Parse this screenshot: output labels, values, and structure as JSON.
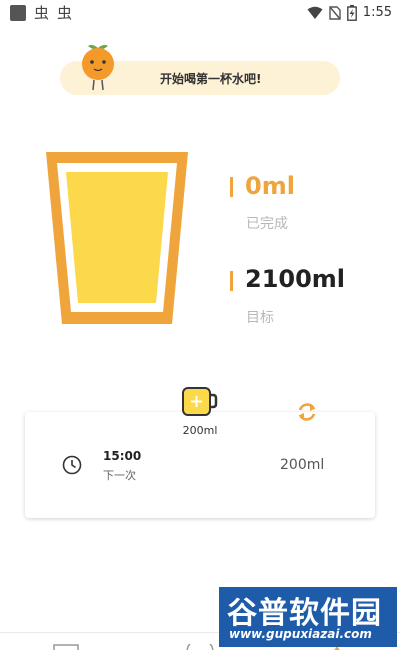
{
  "status_bar": {
    "app_icons": [
      "虫",
      "虫"
    ],
    "time": "1:55",
    "icons": [
      "wifi-icon",
      "no-sim-icon",
      "battery-charging-icon"
    ]
  },
  "banner": {
    "text": "开始喝第一杯水吧!",
    "mascot": "orange-mascot-icon"
  },
  "stats": {
    "completed_value": "0ml",
    "completed_label": "已完成",
    "target_value": "2100ml",
    "target_label": "目标",
    "completed_fraction": 0
  },
  "reminder": {
    "cup_size": "200ml",
    "time": "15:00",
    "next_label": "下一次",
    "amount": "200ml"
  },
  "colors": {
    "accent_orange": "#f0a43c",
    "cup_fill": "#fbd94a",
    "completed_value": "#f0a43c",
    "target_value": "#222222",
    "watermark_bg": "#1e5ba8"
  },
  "watermark": {
    "title": "谷普软件园",
    "url": "www.gupuxiazai.com"
  }
}
